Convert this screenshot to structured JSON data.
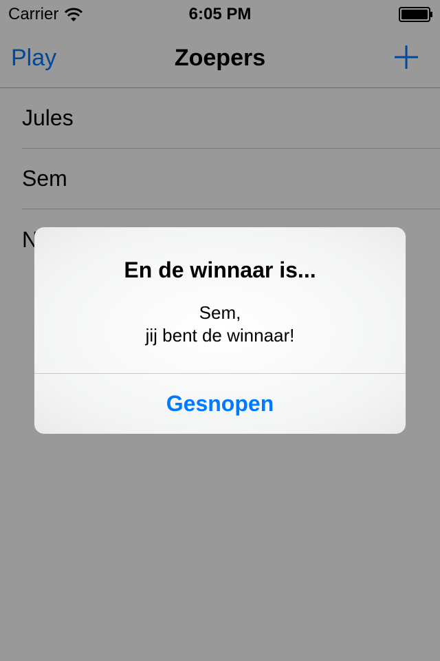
{
  "status_bar": {
    "carrier": "Carrier",
    "time": "6:05 PM",
    "wifi_icon": "wifi-icon",
    "battery_icon": "battery-icon"
  },
  "nav": {
    "left_button": "Play",
    "title": "Zoepers",
    "right_icon": "plus-icon"
  },
  "list": {
    "items": [
      {
        "label": "Jules"
      },
      {
        "label": "Sem"
      },
      {
        "label": "Niels"
      }
    ]
  },
  "alert": {
    "title": "En de winnaar is...",
    "message_line1": "Sem,",
    "message_line2": "jij bent de winnaar!",
    "button": "Gesnopen"
  },
  "colors": {
    "accent": "#007aff",
    "overlay": "rgba(0,0,0,0.4)"
  }
}
